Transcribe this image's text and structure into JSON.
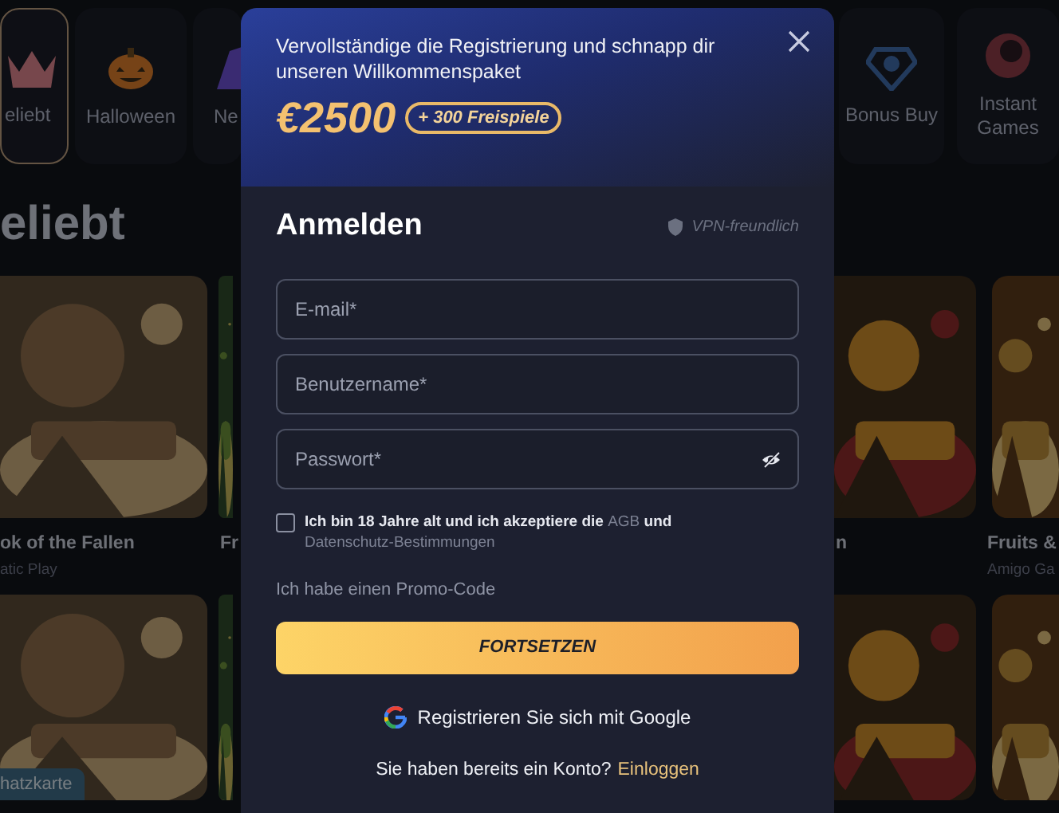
{
  "categories": [
    {
      "label": "eliebt",
      "selected": true
    },
    {
      "label": "Halloween",
      "selected": false
    },
    {
      "label": "Ne",
      "selected": false
    },
    {
      "label": "Bonus Buy",
      "selected": false
    },
    {
      "label": "Instant Games",
      "selected": false
    }
  ],
  "section_title": "eliebt",
  "games": [
    {
      "kind": "picture",
      "title": "ok of the Fallen",
      "provider": "atic Play"
    },
    {
      "kind": "picture",
      "title": "Fr"
    },
    {
      "kind": "picture",
      "title": "n"
    },
    {
      "kind": "picture",
      "title": "Fruits &",
      "provider": "Amigo Ga"
    },
    {
      "kind": "picture",
      "badge": "hatzkarte"
    },
    {
      "kind": "picture"
    },
    {
      "kind": "picture"
    },
    {
      "kind": "picture"
    }
  ],
  "modal": {
    "promo_text": "Vervollständige die Registrierung und schnapp dir unseren Willkommenspaket",
    "amount": "€2500",
    "bonus": "+ 300 Freispiele",
    "title": "Anmelden",
    "vpn_note": "VPN-freundlich",
    "fields": [
      {
        "placeholder": "E-mail*",
        "kind": "text"
      },
      {
        "placeholder": "Benutzername*",
        "kind": "text"
      },
      {
        "placeholder": "Passwort*",
        "kind": "password"
      }
    ],
    "consent": {
      "text": "Ich bin 18 Jahre alt und ich akzeptiere die",
      "link_1": "AGB",
      "middle": "und",
      "link_2": "Datenschutz-Bestimmungen",
      "checked": false
    },
    "promo_code_link": "Ich habe einen Promo-Code",
    "submit": "FORTSETZEN",
    "google": "Registrieren Sie sich mit Google",
    "login_prompt": "Sie haben bereits ein Konto?",
    "login_link": "Einloggen"
  }
}
